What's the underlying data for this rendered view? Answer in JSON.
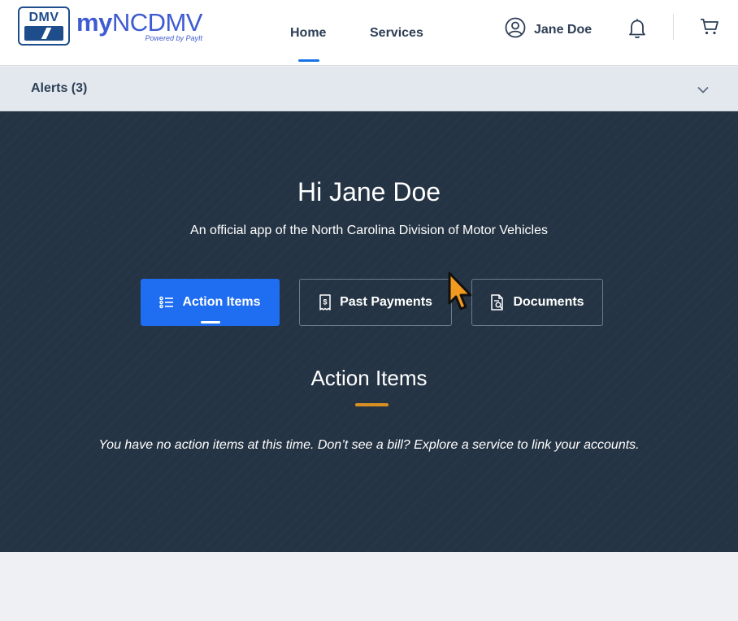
{
  "header": {
    "logo": {
      "badge_text": "DMV",
      "brand_prefix": "my",
      "brand_name": "NCDMV",
      "powered_by": "Powered by PayIt"
    },
    "nav": [
      {
        "label": "Home",
        "active": true
      },
      {
        "label": "Services",
        "active": false
      }
    ],
    "user": {
      "name": "Jane Doe",
      "icon": "user-circle-icon"
    },
    "notification_icon": "bell-icon",
    "cart_icon": "cart-icon"
  },
  "alerts": {
    "label": "Alerts (3)",
    "icon": "chevron-down-icon"
  },
  "hero": {
    "greeting": "Hi Jane Doe",
    "subtitle": "An official app of the North Carolina Division of Motor Vehicles",
    "tabs": [
      {
        "label": "Action Items",
        "icon": "list-icon",
        "active": true
      },
      {
        "label": "Past Payments",
        "icon": "receipt-icon",
        "active": false
      },
      {
        "label": "Documents",
        "icon": "document-icon",
        "active": false
      }
    ],
    "section_title": "Action Items",
    "empty_message": "You have no action items at this time. Don’t see a bill? Explore a service to link your accounts."
  },
  "colors": {
    "primary": "#1f6df0",
    "hero_bg": "#253444",
    "accent_gold": "#d99022",
    "brand_blue": "#3f5bd1",
    "text_dark": "#2c3e55"
  }
}
